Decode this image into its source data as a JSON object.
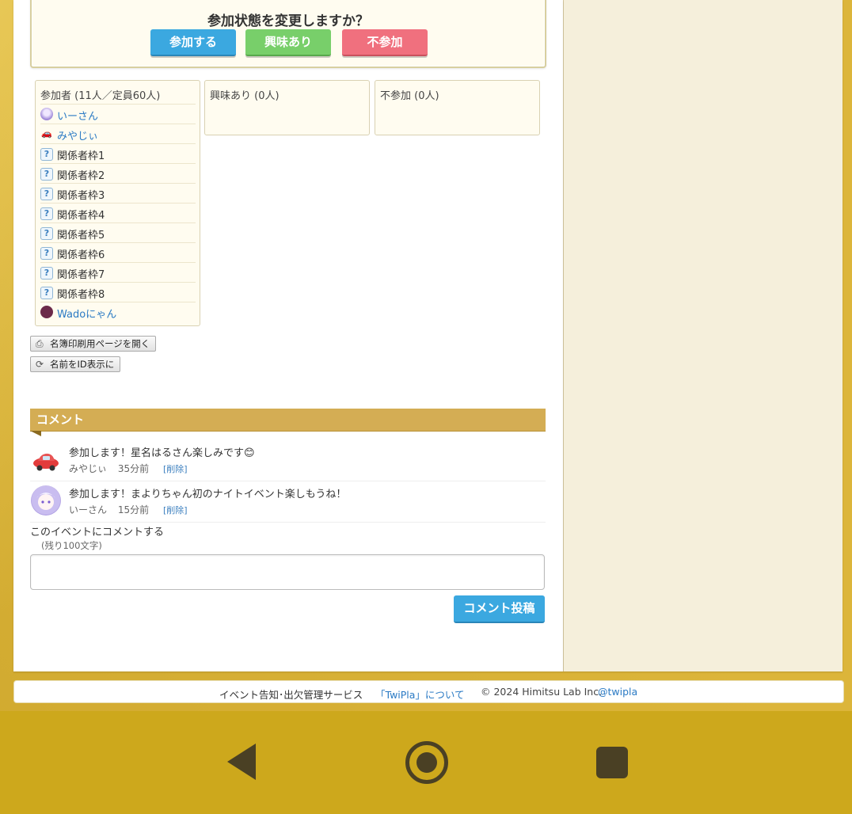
{
  "status": {
    "title": "参加状態を変更しますか？",
    "attend_label": "参加する",
    "interest_label": "興味あり",
    "absent_label": "不参加"
  },
  "participants": {
    "attending": {
      "header": "参加者 (11人／定員60人)",
      "items": [
        {
          "name": "いーさん",
          "icon": "avatar-icon",
          "link": true
        },
        {
          "name": "みやじぃ",
          "icon": "car-icon",
          "link": true
        },
        {
          "name": "関係者枠1",
          "icon": "question-icon",
          "link": false
        },
        {
          "name": "関係者枠2",
          "icon": "question-icon",
          "link": false
        },
        {
          "name": "関係者枠3",
          "icon": "question-icon",
          "link": false
        },
        {
          "name": "関係者枠4",
          "icon": "question-icon",
          "link": false
        },
        {
          "name": "関係者枠5",
          "icon": "question-icon",
          "link": false
        },
        {
          "name": "関係者枠6",
          "icon": "question-icon",
          "link": false
        },
        {
          "name": "関係者枠7",
          "icon": "question-icon",
          "link": false
        },
        {
          "name": "関係者枠8",
          "icon": "question-icon",
          "link": false
        },
        {
          "name": "Wadoにゃん",
          "icon": "avatar-icon",
          "link": true
        }
      ]
    },
    "interested": {
      "header": "興味あり (0人)"
    },
    "absent": {
      "header": "不参加 (0人)"
    }
  },
  "tools": {
    "print_label": "名簿印刷用ページを開く",
    "id_toggle_label": "名前をID表示に"
  },
  "comments": {
    "header": "コメント",
    "items": [
      {
        "text": "参加します！星名はるさん楽しみです😊",
        "author": "みやじぃ",
        "time": "35分前",
        "delete_label": "[削除]"
      },
      {
        "text": "参加します！まよりちゃん初のナイトイベント楽しもうね！",
        "author": "いーさん",
        "time": "15分前",
        "delete_label": "[削除]"
      }
    ],
    "form_label": "このイベントにコメントする",
    "remaining": "(残り100文字)",
    "input_value": "",
    "post_label": "コメント投稿"
  },
  "footer": {
    "service": "イベント告知･出欠管理サービス",
    "about_link": "「TwiPla」について",
    "copyright": "© 2024 Himitsu Lab Inc.",
    "twitter": "@twipla"
  },
  "colors": {
    "accent_blue": "#3ba8e0",
    "interest_green": "#78cf6a",
    "absent_red": "#f0707e",
    "comment_header": "#d4ad54",
    "background_gold": "#dcb53a"
  }
}
